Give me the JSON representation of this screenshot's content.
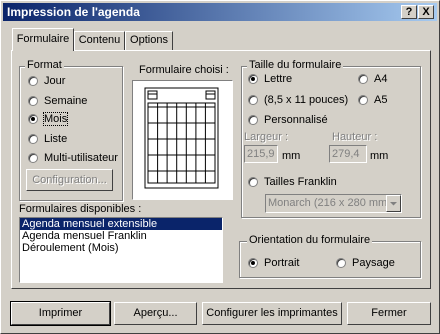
{
  "window": {
    "title": "Impression de l'agenda",
    "help_glyph": "?",
    "close_glyph": "X"
  },
  "tabs": [
    {
      "label": "Formulaire",
      "active": true
    },
    {
      "label": "Contenu",
      "active": false
    },
    {
      "label": "Options",
      "active": false
    }
  ],
  "format": {
    "legend": "Format",
    "options": [
      {
        "label": "Jour",
        "selected": false
      },
      {
        "label": "Semaine",
        "selected": false
      },
      {
        "label": "Mois",
        "selected": true
      },
      {
        "label": "Liste",
        "selected": false
      },
      {
        "label": "Multi-utilisateur",
        "selected": false
      }
    ],
    "configuration_label": "Configuration..."
  },
  "preview": {
    "label": "Formulaire choisi :"
  },
  "available": {
    "label": "Formulaires disponibles :",
    "items": [
      {
        "label": "Agenda mensuel extensible",
        "selected": true
      },
      {
        "label": "Agenda mensuel Franklin",
        "selected": false
      },
      {
        "label": "Déroulement (Mois)",
        "selected": false
      }
    ]
  },
  "size": {
    "legend": "Taille du formulaire",
    "options": {
      "lettre": {
        "label": "Lettre",
        "selected": true
      },
      "a4": {
        "label": "A4",
        "selected": false
      },
      "half": {
        "label": "(8,5 x 11 pouces)",
        "selected": false
      },
      "a5": {
        "label": "A5",
        "selected": false
      },
      "custom": {
        "label": "Personnalisé",
        "selected": false
      }
    },
    "width_label": "Largeur :",
    "height_label": "Hauteur :",
    "width_value": "215,9",
    "height_value": "279,4",
    "unit": "mm",
    "franklin_label": "Tailles Franklin",
    "franklin_selected": false,
    "franklin_value": "Monarch   (216 x 280 mm"
  },
  "orientation": {
    "legend": "Orientation du formulaire",
    "portrait_label": "Portrait",
    "portrait_selected": true,
    "landscape_label": "Paysage",
    "landscape_selected": false
  },
  "buttons": {
    "print": "Imprimer",
    "preview": "Aperçu...",
    "configure": "Configurer les imprimantes",
    "close": "Fermer"
  }
}
